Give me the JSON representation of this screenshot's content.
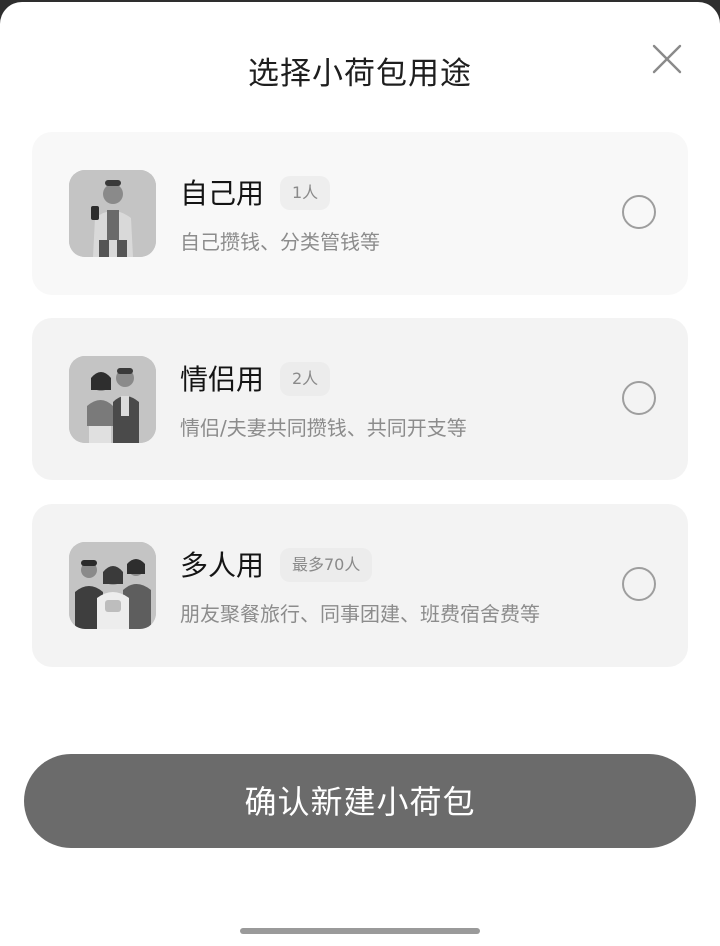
{
  "sheet": {
    "title": "选择小荷包用途",
    "close_icon": "close-icon"
  },
  "options": [
    {
      "name": "自己用",
      "badge": "1人",
      "desc": "自己攒钱、分类管钱等",
      "selected": false,
      "icon": "single-person-avatar"
    },
    {
      "name": "情侣用",
      "badge": "2人",
      "desc": "情侣/夫妻共同攒钱、共同开支等",
      "selected": false,
      "icon": "couple-avatar"
    },
    {
      "name": "多人用",
      "badge": "最多70人",
      "desc": "朋友聚餐旅行、同事团建、班费宿舍费等",
      "selected": false,
      "icon": "group-avatar"
    }
  ],
  "confirm": {
    "label": "确认新建小荷包"
  }
}
